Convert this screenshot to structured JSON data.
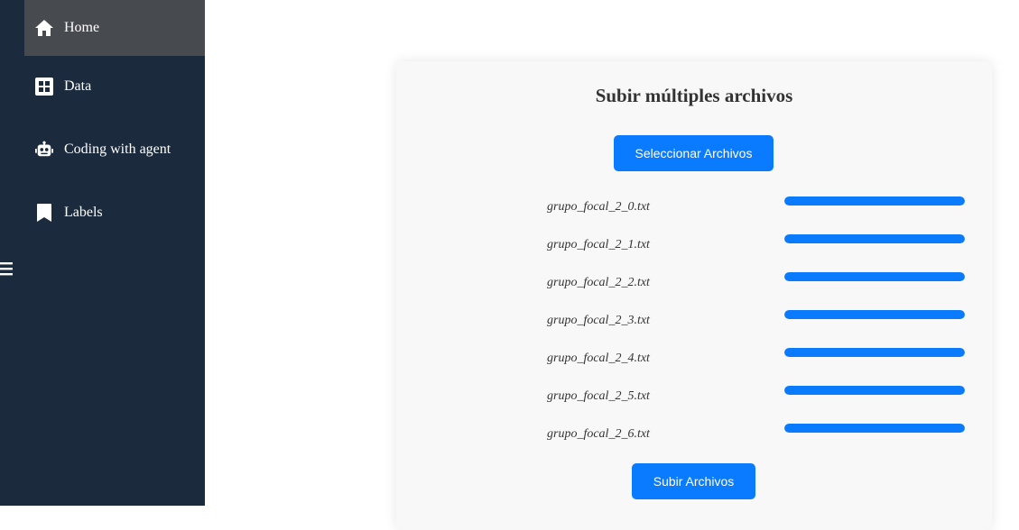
{
  "sidebar": {
    "items": [
      {
        "label": "Home",
        "icon": "home-icon",
        "active": true
      },
      {
        "label": "Data",
        "icon": "grid-icon",
        "active": false
      },
      {
        "label": "Coding with agent",
        "icon": "robot-icon",
        "active": false
      },
      {
        "label": "Labels",
        "icon": "bookmark-icon",
        "active": false
      }
    ],
    "toggle_icon": "hamburger-icon"
  },
  "upload": {
    "title": "Subir múltiples archivos",
    "select_label": "Seleccionar Archivos",
    "upload_label": "Subir Archivos",
    "files": [
      {
        "name": "grupo_focal_2_0.txt",
        "progress": 1.0
      },
      {
        "name": "grupo_focal_2_1.txt",
        "progress": 1.0
      },
      {
        "name": "grupo_focal_2_2.txt",
        "progress": 1.0
      },
      {
        "name": "grupo_focal_2_3.txt",
        "progress": 1.0
      },
      {
        "name": "grupo_focal_2_4.txt",
        "progress": 1.0
      },
      {
        "name": "grupo_focal_2_5.txt",
        "progress": 1.0
      },
      {
        "name": "grupo_focal_2_6.txt",
        "progress": 1.0
      }
    ]
  },
  "colors": {
    "sidebar_bg": "#1b2a3d",
    "active_item_bg": "#474b4f",
    "accent": "#0a7bff",
    "card_bg": "#f8f8f8"
  }
}
